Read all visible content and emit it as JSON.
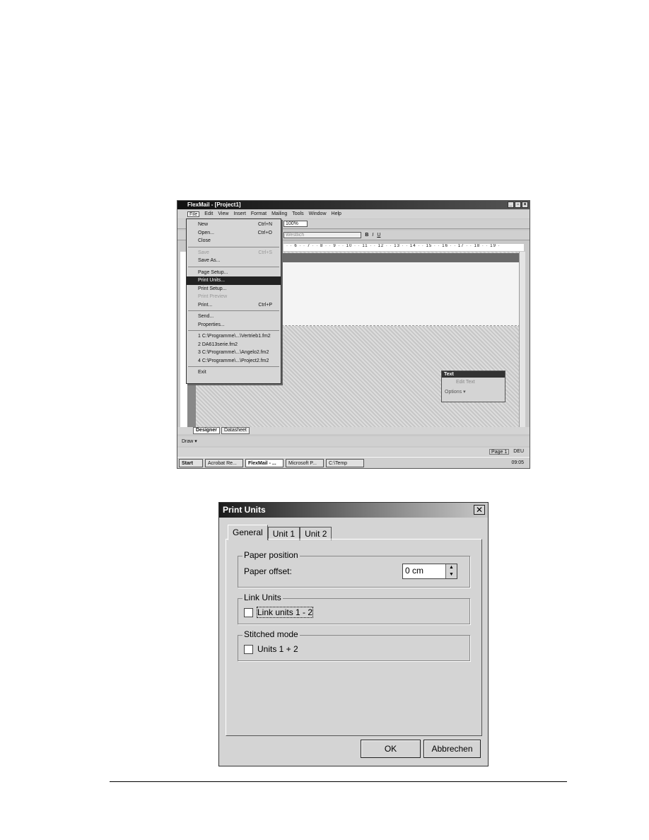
{
  "app": {
    "title": "FlexMail - [Project1]",
    "menu": [
      "File",
      "Edit",
      "View",
      "Insert",
      "Format",
      "Mailing",
      "Tools",
      "Window",
      "Help"
    ],
    "zoom": "100%",
    "font": "Westlich",
    "ruler": "· · 6 · · 7 · · 8 · · 9 · · 10 · · 11 · · 12 · · 13 · · 14 · · 15 · · 16 · · 17 · · 18 · · 19 ·",
    "file_menu": [
      {
        "label": "New",
        "shortcut": "Ctrl+N"
      },
      {
        "label": "Open...",
        "shortcut": "Ctrl+O"
      },
      {
        "label": "Close",
        "shortcut": ""
      },
      "-",
      {
        "label": "Save",
        "shortcut": "Ctrl+S",
        "disabled": true
      },
      {
        "label": "Save As...",
        "shortcut": ""
      },
      "-",
      {
        "label": "Page Setup...",
        "shortcut": ""
      },
      {
        "label": "Print Units...",
        "shortcut": "",
        "selected": true
      },
      {
        "label": "Print Setup...",
        "shortcut": ""
      },
      {
        "label": "Print Preview",
        "shortcut": "",
        "disabled": true
      },
      {
        "label": "Print...",
        "shortcut": "Ctrl+P"
      },
      "-",
      {
        "label": "Send...",
        "shortcut": ""
      },
      {
        "label": "Properties...",
        "shortcut": ""
      },
      "-",
      {
        "label": "1 C:\\Programme\\...\\Vertrieb1.fm2",
        "shortcut": ""
      },
      {
        "label": "2 DA613serie.fm2",
        "shortcut": ""
      },
      {
        "label": "3 C:\\Programme\\...\\Angelo2.fm2",
        "shortcut": ""
      },
      {
        "label": "4 C:\\Programme\\...\\Project2.fm2",
        "shortcut": ""
      },
      "-",
      {
        "label": "Exit",
        "shortcut": ""
      }
    ],
    "text_toolbar": {
      "title": "Text",
      "edit": "Edit Text",
      "options": "Options ▾"
    },
    "sheet_tabs": [
      "Designer",
      "Datasheet"
    ],
    "draw_label": "Draw ▾",
    "status": {
      "page": "Page 1",
      "lang": "DEU"
    },
    "taskbar": {
      "start": "Start",
      "tasks": [
        "Acrobat Re...",
        "FlexMail - ...",
        "Microsoft P...",
        "C:\\Temp"
      ],
      "clock": "09:05"
    }
  },
  "dialog": {
    "title": "Print Units",
    "tabs": [
      "General",
      "Unit 1",
      "Unit 2"
    ],
    "paper_group": "Paper position",
    "paper_offset_label": "Paper offset:",
    "paper_offset_value": "0 cm",
    "link_group": "Link Units",
    "link_checkbox": "Link units 1 - 2",
    "link_checked": false,
    "stitched_group": "Stitched mode",
    "stitched_checkbox": "Units 1 + 2",
    "stitched_checked": false,
    "ok": "OK",
    "cancel": "Abbrechen"
  }
}
